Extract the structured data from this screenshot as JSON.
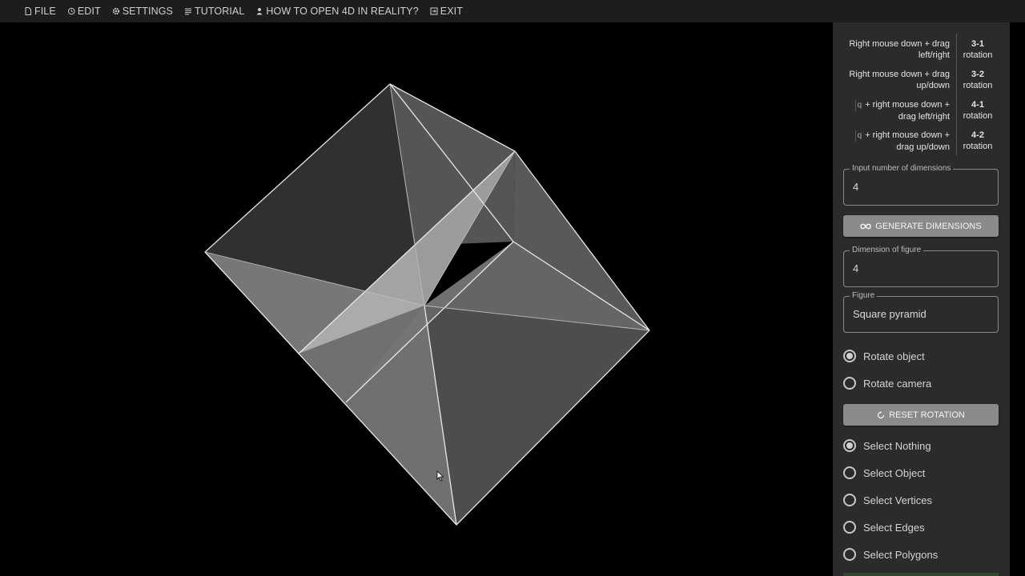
{
  "menu": [
    {
      "label": "FILE",
      "icon": "file-icon"
    },
    {
      "label": "EDIT",
      "icon": "history-icon"
    },
    {
      "label": "SETTINGS",
      "icon": "gear-icon"
    },
    {
      "label": "TUTORIAL",
      "icon": "list-icon"
    },
    {
      "label": "HOW TO OPEN 4D IN REALITY?",
      "icon": "person-icon"
    },
    {
      "label": "EXIT",
      "icon": "exit-icon"
    }
  ],
  "hints": [
    {
      "action": [
        "Right mouse down + drag",
        "left/right"
      ],
      "key": "",
      "axes": "3-1",
      "effect": "rotation"
    },
    {
      "action": [
        "Right mouse down + drag",
        "up/down"
      ],
      "key": "",
      "axes": "3-2",
      "effect": "rotation"
    },
    {
      "action": [
        "+ right mouse down +",
        "drag left/right"
      ],
      "key": "q",
      "axes": "4-1",
      "effect": "rotation"
    },
    {
      "action": [
        "+ right mouse down +",
        "drag up/down"
      ],
      "key": "q",
      "axes": "4-2",
      "effect": "rotation"
    }
  ],
  "dimensions_input": {
    "label": "Input number of dimensions",
    "value": "4"
  },
  "generate_button": {
    "label": "GENERATE DIMENSIONS",
    "icon": "infinity-icon"
  },
  "figure_dimension": {
    "label": "Dimension of figure",
    "value": "4"
  },
  "figure": {
    "label": "Figure",
    "value": "Square pyramid"
  },
  "rotate_mode": [
    {
      "label": "Rotate object",
      "selected": true
    },
    {
      "label": "Rotate camera",
      "selected": false
    }
  ],
  "reset_button": {
    "label": "RESET ROTATION",
    "icon": "reset-icon"
  },
  "select_mode": [
    {
      "label": "Select Nothing",
      "selected": true
    },
    {
      "label": "Select Object",
      "selected": false
    },
    {
      "label": "Select Vertices",
      "selected": false
    },
    {
      "label": "Select Edges",
      "selected": false
    },
    {
      "label": "Select Polygons",
      "selected": false
    }
  ],
  "colors": {
    "menubar": "#1d1d1d",
    "panel": "#2b2b2b",
    "button": "#8a8a8a",
    "background": "#000000"
  }
}
